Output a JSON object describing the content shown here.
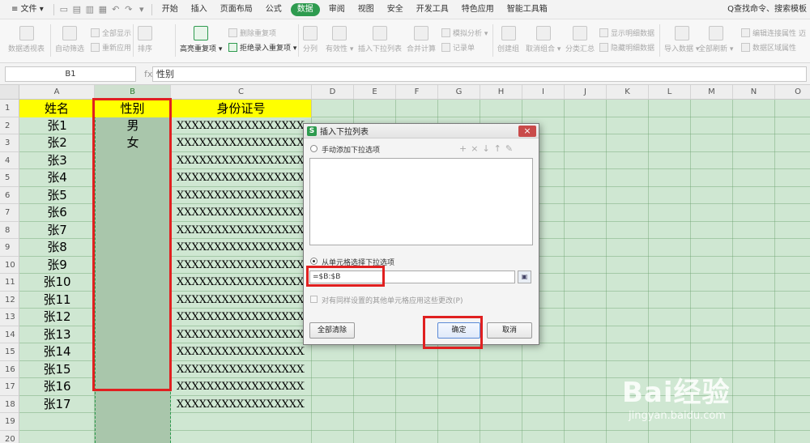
{
  "menubar": {
    "file_label": "≡ 文件 ▾",
    "tabs": [
      "开始",
      "插入",
      "页面布局",
      "公式",
      "数据",
      "审阅",
      "视图",
      "安全",
      "开发工具",
      "特色应用",
      "智能工具箱"
    ],
    "active_tab": "数据",
    "search_label": "Q查找命令、搜索模板"
  },
  "ribbon": {
    "pivot": "数据透视表",
    "autofilter": "自动筛选",
    "show_all": "全部显示",
    "reapply": "重新应用",
    "sort": "排序",
    "highlight_dup": "高亮重复项 ▾",
    "delete_dup": "删除重复项",
    "reject_dup": "拒绝录入重复项 ▾",
    "split": "分列",
    "validity": "有效性 ▾",
    "insert_dropdown": "插入下拉列表",
    "merge_calc": "合并计算",
    "what_if": "模拟分析 ▾",
    "record": "记录单",
    "group": "创建组",
    "ungroup": "取消组合 ▾",
    "subtotal": "分类汇总",
    "show_detail": "显示明细数据",
    "hide_detail": "隐藏明细数据",
    "import": "导入数据 ▾",
    "refresh_all": "全部刷新 ▾",
    "edit_links": "编辑连接属性",
    "range_props": "数据区域属性",
    "extra": "迈"
  },
  "formula": {
    "namebox": "B1",
    "fx": "fx",
    "content": "性别"
  },
  "sheet": {
    "columns": [
      "A",
      "B",
      "C",
      "D",
      "E",
      "F",
      "G",
      "H",
      "I",
      "J",
      "K",
      "L",
      "M",
      "N",
      "O"
    ],
    "rows": [
      "1",
      "2",
      "3",
      "4",
      "5",
      "6",
      "7",
      "8",
      "9",
      "10",
      "11",
      "12",
      "13",
      "14",
      "15",
      "16",
      "17",
      "18",
      "19",
      "20"
    ],
    "header": {
      "a": "姓名",
      "b": "性别",
      "c": "身份证号"
    },
    "names": [
      "张1",
      "张2",
      "张3",
      "张4",
      "张5",
      "张6",
      "张7",
      "张8",
      "张9",
      "张10",
      "张11",
      "张12",
      "张13",
      "张14",
      "张15",
      "张16",
      "张17"
    ],
    "genders": [
      "男",
      "女"
    ],
    "id_value": "XXXXXXXXXXXXXXXXXX"
  },
  "dialog": {
    "title": "插入下拉列表",
    "logo": "S",
    "close": "×",
    "manual_option": "手动添加下拉选项",
    "tool_icons": [
      "+",
      "×",
      "↓",
      "↑",
      "✎"
    ],
    "from_cells_option": "从单元格选择下拉选项",
    "range_value": "=$B:$B",
    "range_btn": "▣",
    "apply_same": "对有同样设置的其他单元格应用这些更改(P)",
    "clear_all": "全部清除",
    "ok": "确定",
    "cancel": "取消"
  },
  "watermark": {
    "main": "Bai经验",
    "sub": "jingyan.baidu.com"
  },
  "colors": {
    "accent": "#2e9b4f",
    "header_yellow": "#ffff00",
    "highlight_red": "#e02020"
  }
}
